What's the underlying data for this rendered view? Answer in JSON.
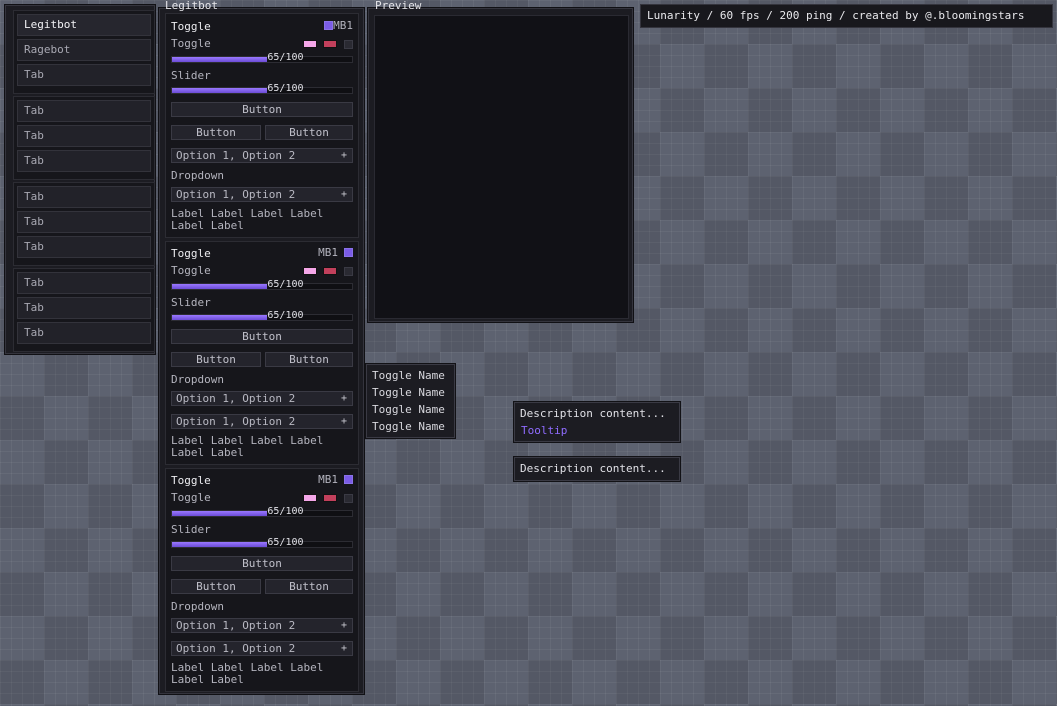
{
  "tabs_window": {
    "groups": [
      [
        "Legitbot",
        "Ragebot",
        "Tab"
      ],
      [
        "Tab",
        "Tab",
        "Tab"
      ],
      [
        "Tab",
        "Tab",
        "Tab"
      ],
      [
        "Tab",
        "Tab",
        "Tab"
      ]
    ],
    "active": "Legitbot"
  },
  "legitbot_window": {
    "title": "Legitbot",
    "sections": [
      {
        "header": "Toggle",
        "mb": "MB1",
        "toggle_label": "Toggle",
        "slider1_value": "65/100",
        "slider1_fraction": 0.53,
        "slider_label": "Slider",
        "slider2_value": "65/100",
        "slider2_fraction": 0.53,
        "button_wide": "Button",
        "button_left": "Button",
        "button_right": "Button",
        "dropdown_label": "Dropdown",
        "dropdown1": "Option 1, Option 2",
        "dropdown2": "Option 1, Option 2",
        "labels": "Label Label Label Label Label Label"
      },
      {
        "header": "Toggle",
        "mb": "MB1",
        "toggle_label": "Toggle",
        "slider1_value": "65/100",
        "slider1_fraction": 0.53,
        "slider_label": "Slider",
        "slider2_value": "65/100",
        "slider2_fraction": 0.53,
        "button_wide": "Button",
        "button_left": "Button",
        "button_right": "Button",
        "dropdown_label": "Dropdown",
        "dropdown1": "Option 1, Option 2",
        "dropdown2": "Option 1, Option 2",
        "labels": "Label Label Label Label Label Label"
      },
      {
        "header": "Toggle",
        "mb": "MB1",
        "toggle_label": "Toggle",
        "slider1_value": "65/100",
        "slider1_fraction": 0.53,
        "slider_label": "Slider",
        "slider2_value": "65/100",
        "slider2_fraction": 0.53,
        "button_wide": "Button",
        "button_left": "Button",
        "button_right": "Button",
        "dropdown_label": "Dropdown",
        "dropdown1": "Option 1, Option 2",
        "dropdown2": "Option 1, Option 2",
        "labels": "Label Label Label Label Label Label"
      }
    ]
  },
  "preview": {
    "title": "Preview"
  },
  "toggle_list": [
    "Toggle Name",
    "Toggle Name",
    "Toggle Name",
    "Toggle Name"
  ],
  "tooltip1": {
    "description": "Description content...",
    "tooltip": "Tooltip"
  },
  "tooltip2": {
    "description": "Description content..."
  },
  "watermark": "Lunarity / 60 fps / 200 ping / created by @.bloomingstars",
  "colors": {
    "accent": "#7b5ce6",
    "swatch_pink": "#f4a6e8",
    "swatch_red": "#c2405c",
    "swatch_off": "#2c2c33"
  },
  "icons": {
    "dropdown_expand": "plus-icon"
  }
}
